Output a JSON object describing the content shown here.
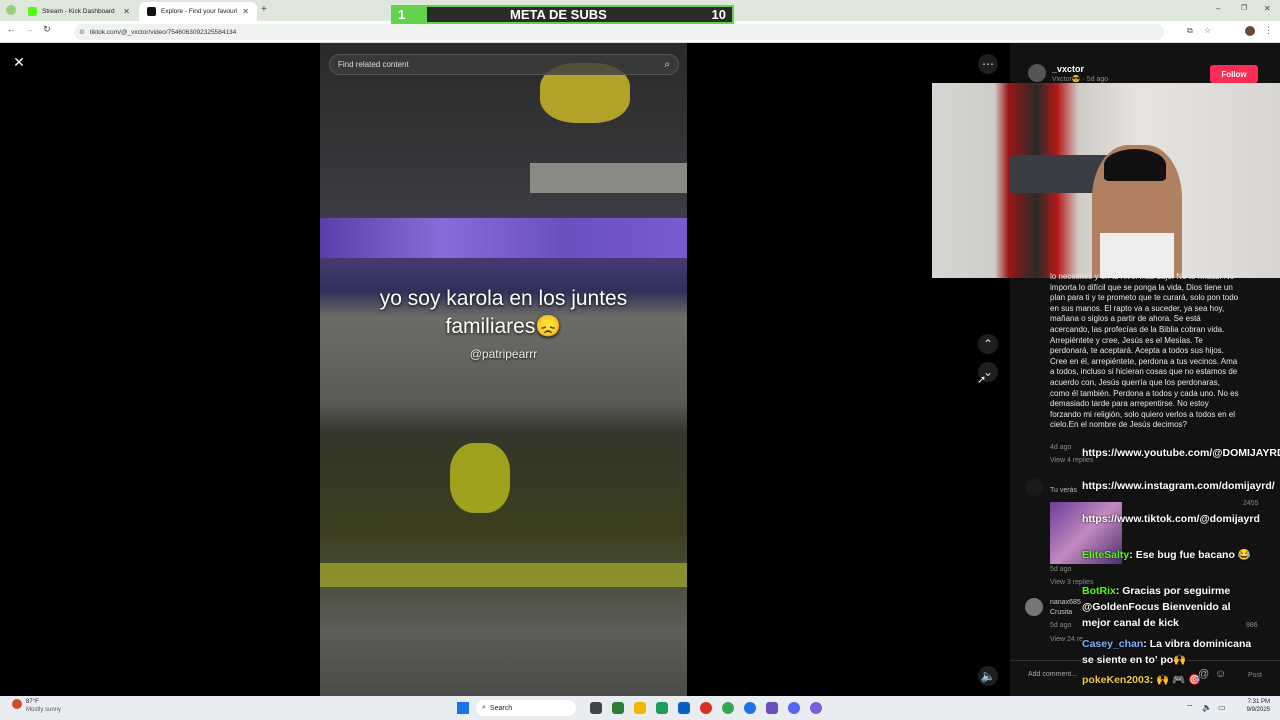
{
  "browser": {
    "tabs": [
      {
        "label": "Stream - Kick Dashboard"
      },
      {
        "label": "Explore - Find your favourit"
      }
    ],
    "url": "tiktok.com/@_vxctor/video/7546063092325584134"
  },
  "overlay": {
    "goal_title": "META DE SUBS",
    "goal_current": "1",
    "goal_target": "10",
    "progress": 0.1
  },
  "video": {
    "search_placeholder": "Find related content",
    "caption_line1": "yo soy karola en los juntes",
    "caption_line2": "familiares😞",
    "handle": "@patripearrr"
  },
  "post": {
    "author": "_vxctor",
    "sub": "Vxctor😎 · 5d ago",
    "follow_label": "Follow",
    "long_comment": "lo necesites y en tu nivel más bajo. No te rindas. No importa lo difícil que se ponga la vida, Dios tiene un plan para ti y te prometo que te curará, solo pon todo en sus manos. El rapto va a suceder, ya sea hoy, mañana o siglos a partir de ahora. Se está acercando, las profecías de la Biblia cobran vida. Arrepiéntete y cree, Jesús es el Mesías. Te perdonará, te aceptará. Acepta a todos sus hijos. Cree en él, arrepiéntete, perdona a tus vecinos. Ama a todos, incluso si hicieran cosas que no estamos de acuerdo con, Jesús querría que los perdonaras, como él también. Perdona a todos y cada uno. No es demasiado tarde para arrepentirse. No estoy forzando mi religión, solo quiero verlos a todos en el cielo.En el nombre de Jesús decimos?",
    "long_comment_meta": "4d ago",
    "view_replies_1": "View 4 replies",
    "tu_veras": "Tu verás",
    "likes_1": "2455",
    "meta_2": "5d ago",
    "view_replies_2": "View 3 replies",
    "user_3": "nanax685",
    "text_3": "Crusita",
    "meta_3": "5d ago",
    "likes_3": "986",
    "view_replies_3": "View 24 re",
    "add_comment_placeholder": "Add comment...",
    "post_label": "Post"
  },
  "chat": [
    {
      "user": "",
      "text": "https://www.youtube.com/@DOMIJAYRD",
      "color": "#ffffff"
    },
    {
      "user": "",
      "text": "https://www.instagram.com/domijayrd/",
      "color": "#ffffff"
    },
    {
      "user": "",
      "text": "https://www.tiktok.com/@domijayrd",
      "color": "#ffffff"
    },
    {
      "user": "EliteSalty",
      "text": ": Ese bug fue bacano 😂",
      "color": "#53fc18"
    },
    {
      "user": "BotRix",
      "text": ": Gracias por seguirme @GoldenFocus Bienvenido al mejor canal de kick",
      "color": "#53fc18"
    },
    {
      "user": "Casey_chan",
      "text": ": La vibra dominicana se siente en to' po🙌",
      "color": "#7fb2ff"
    },
    {
      "user": "pokeKen2003",
      "text": ": 🙌 🎮 🎯",
      "color": "#f5c842"
    }
  ],
  "taskbar": {
    "weather_temp": "87°F",
    "weather_desc": "Mostly sunny",
    "search_label": "Search",
    "time": "7:31 PM",
    "date": "9/9/2025"
  },
  "colors": {
    "accent_green": "#61d24a",
    "tiktok_red": "#fe2c55",
    "kick_green": "#53fc18"
  }
}
